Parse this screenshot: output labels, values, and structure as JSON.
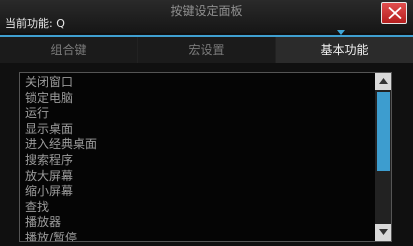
{
  "window": {
    "title": "按键设定面板",
    "current_function_label": "当前功能: Q"
  },
  "tabs": [
    {
      "label": "组合键"
    },
    {
      "label": "宏设置"
    },
    {
      "label": "基本功能"
    }
  ],
  "active_tab": "基本功能",
  "function_list": {
    "items": [
      "关闭窗口",
      "锁定电脑",
      "运行",
      "显示桌面",
      "进入经典桌面",
      "搜索程序",
      "放大屏幕",
      "缩小屏幕",
      "查找",
      "播放器",
      "播放/暂停"
    ]
  },
  "colors": {
    "accent": "#3d9dcf",
    "close_button": "#c93535",
    "background": "#101010"
  },
  "icons": {
    "close": "close-icon",
    "scroll_up": "arrow-up-icon",
    "scroll_down": "arrow-down-icon"
  }
}
